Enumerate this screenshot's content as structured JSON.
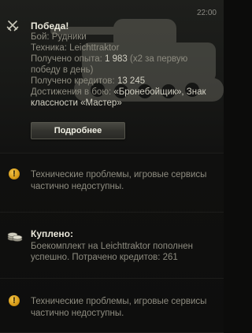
{
  "time": "22:00",
  "victory": {
    "icon": "crossed-swords-icon",
    "title": "Победа!",
    "lines": {
      "battle": "Бой: Рудники",
      "vehicle": "Техника: Leichttraktor",
      "xp_label": "Получено опыта: ",
      "xp_value": "1 983",
      "xp_note": " (x2 за первую победу в день)",
      "credits_label": "Получено кредитов: ",
      "credits_value": "13 245",
      "achievements_label": "Достижения в бою: ",
      "achievements_value": "«Бронебойщик», Знак классности «Мастер»"
    },
    "details_button": "Подробнее"
  },
  "warning1": {
    "icon": "warning-icon",
    "text": "Технические проблемы, игровые сервисы частично недоступны."
  },
  "bought": {
    "icon": "coins-icon",
    "title": "Куплено:",
    "body": "Боекомплект на Leichttraktor пополнен успешно. Потрачено кредитов: 261"
  },
  "warning2": {
    "icon": "warning-icon",
    "text": "Технические проблемы, игровые сервисы частично недоступны."
  },
  "colors": {
    "title": "#ebe9dc",
    "secondary_text": "#8e8c80",
    "warning": "#e0a526"
  }
}
